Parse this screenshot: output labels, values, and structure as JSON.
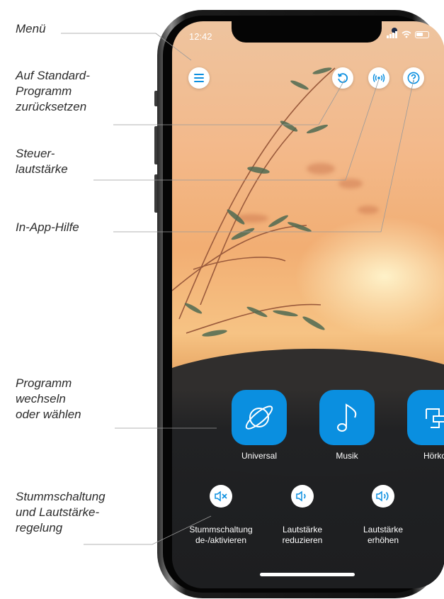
{
  "annotations": {
    "menu": "Menü",
    "reset": "Auf Standard-\nProgramm\nzurücksetzen",
    "control_volume": "Steuer-\nlautstärke",
    "help": "In-App-Hilfe",
    "program": "Programm\nwechseln\noder wählen",
    "mute_volume": "Stummschaltung\nund Lautstärke-\nregelung"
  },
  "status_bar": {
    "time": "12:42"
  },
  "top_buttons": {
    "menu": "menu-icon",
    "reset": "reset-icon",
    "control_volume": "broadcast-icon",
    "help": "help-icon"
  },
  "programs": [
    {
      "label": "Universal",
      "icon": "planet-icon"
    },
    {
      "label": "Musik",
      "icon": "music-note-icon"
    },
    {
      "label": "Hörko",
      "icon": "speech-icon"
    }
  ],
  "volume_controls": [
    {
      "label": "Stummschaltung\nde-/aktivieren",
      "icon": "speaker-mute-icon"
    },
    {
      "label": "Lautstärke\nreduzieren",
      "icon": "speaker-low-icon"
    },
    {
      "label": "Lautstärke\nerhöhen",
      "icon": "speaker-high-icon"
    }
  ],
  "colors": {
    "accent": "#0a8fe0",
    "annotation_text": "#2b2b2b"
  }
}
